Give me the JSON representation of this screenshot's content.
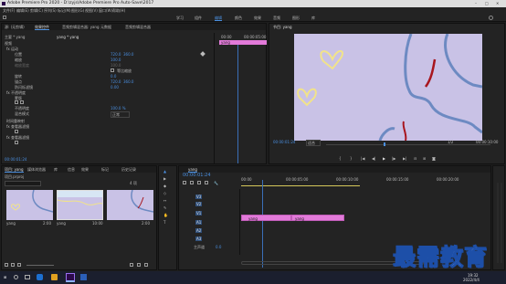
{
  "window": {
    "title": "Adobe Premiere Pro 2020 - D:\\zyjs\\Adobe Premiere Pro Auto-Save\\2017",
    "controls": [
      "–",
      "□",
      "✕"
    ]
  },
  "menu": [
    "文件(F)",
    "编辑(E)",
    "剪辑(C)",
    "序列(S)",
    "标记(M)",
    "图形(G)",
    "视图(V)",
    "窗口(W)",
    "帮助(H)"
  ],
  "workspaces": {
    "tabs": [
      "学习",
      "组件",
      "编辑",
      "颜色",
      "效果",
      "音频",
      "图形",
      "库"
    ],
    "active_index": 2
  },
  "effect_controls": {
    "tabs": [
      "源: (无剪辑)",
      "效果控件",
      "音频剪辑混合器: yang",
      "元数据",
      "音频剪辑混合器"
    ],
    "source": "主要 * yang",
    "clip": "yang * yang",
    "sections": [
      "视频",
      "fx 运动",
      "位置",
      "缩放",
      "缩放宽度",
      "旋转",
      "锚点",
      "防闪烁滤镜",
      "fx 不透明度",
      "蒙版",
      "不透明度",
      "混合模式",
      "时间重映射",
      "fx 查看器滤镜",
      "fx 查看器滤镜"
    ],
    "values": {
      "position": [
        "720.0",
        "360.0"
      ],
      "scale": "100.0",
      "scale_width": "100.0",
      "uniform_scale_label": "等比缩放",
      "rotation": "0.0",
      "anchor": [
        "720.0",
        "360.0"
      ],
      "flicker": "0.00",
      "opacity": "100.0 %",
      "blend": "正常"
    },
    "timeline_ruler": [
      "00:00",
      "00:00:05:00"
    ],
    "clip_label": "yang",
    "timecode": "00:00:01:24"
  },
  "program_monitor": {
    "title": "节目: yang",
    "timecode": "00:00:01:24",
    "fit": "适合",
    "quality": "1/2",
    "duration": "00:00:10:00",
    "canvas_color": "#c9c2e6"
  },
  "project": {
    "tabs": [
      "项目: yang",
      "媒体浏览器",
      "库",
      "信息",
      "效果",
      "标记",
      "历史记录"
    ],
    "search_placeholder": "",
    "count": "4 项",
    "name": "项目.prproj",
    "items": [
      {
        "label": "yang",
        "duration": "2:00"
      },
      {
        "label": "yang",
        "duration": "10:00"
      },
      {
        "label": "",
        "duration": "2:00"
      }
    ]
  },
  "timeline": {
    "tab": "yang",
    "timecode": "00:00:01:24",
    "ruler": [
      "00:00",
      "00:00:05:00",
      "00:00:10:00",
      "00:00:15:00",
      "00:00:20:00"
    ],
    "tracks": [
      "V3",
      "V2",
      "V1",
      "A1",
      "A2",
      "A3"
    ],
    "master": "主声道",
    "master_value": "0.0",
    "clips": [
      {
        "track": "V1",
        "label": "yang"
      },
      {
        "track": "V1",
        "label": "yang"
      }
    ],
    "clip_color": "#e27ad9"
  },
  "taskbar": {
    "time": "19:32",
    "date": "2022/4/4"
  },
  "watermark": "最需教育"
}
